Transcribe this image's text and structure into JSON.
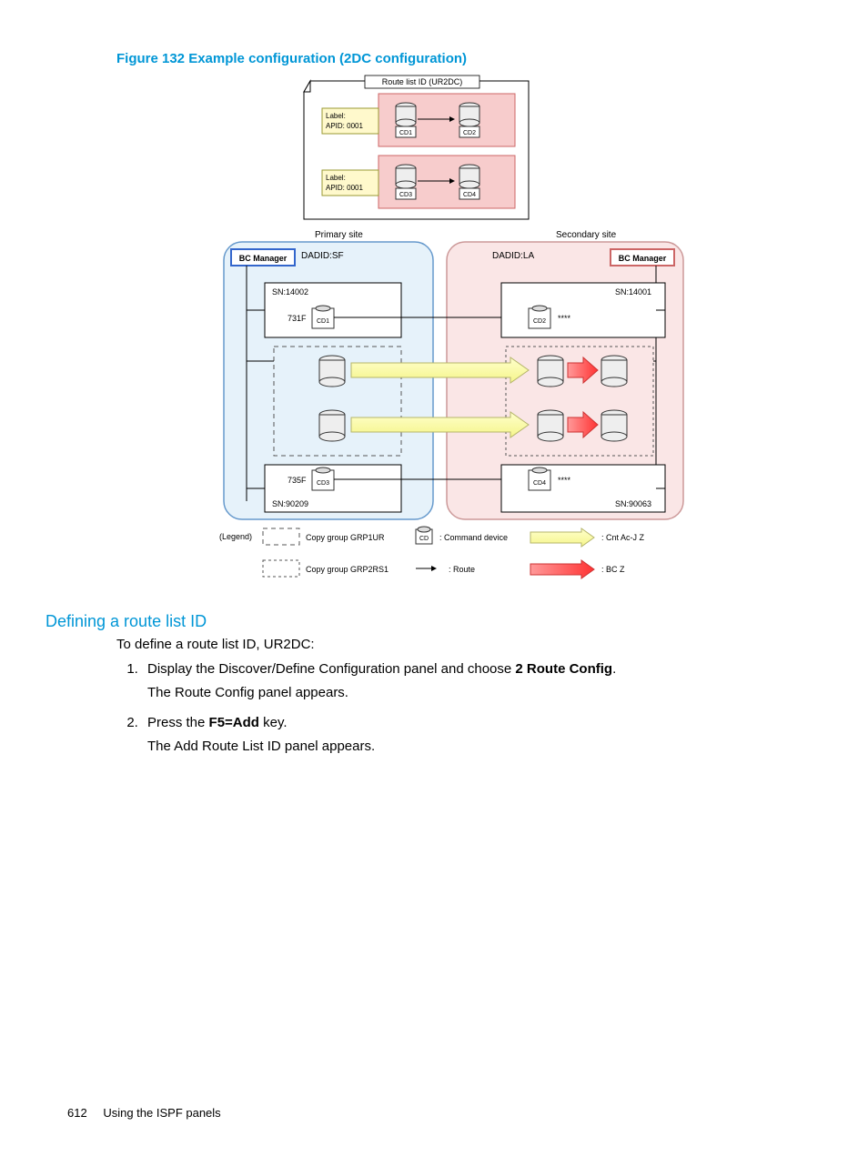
{
  "figure": {
    "caption": "Figure 132 Example configuration (2DC configuration)",
    "routeListId": "Route list ID (UR2DC)",
    "label1": "Label:",
    "apid1": "APID: 0001",
    "label2": "Label:",
    "apid2": "APID: 0001",
    "cd1": "CD1",
    "cd2": "CD2",
    "cd3": "CD3",
    "cd4": "CD4",
    "primarySite": "Primary site",
    "secondarySite": "Secondary site",
    "dadidSF": "DADID:SF",
    "dadidLA": "DADID:LA",
    "bcManagerL": "BC Manager",
    "bcManagerR": "BC Manager",
    "sn14002": "SN:14002",
    "sn14001": "SN:14001",
    "addr731F": "731F",
    "addr735F": "735F",
    "stars": "****",
    "sn90209": "SN:90209",
    "sn90063": "SN:90063",
    "legend": "(Legend)",
    "copyGroup1": "Copy group GRP1UR",
    "copyGroup2": "Copy group GRP2RS1",
    "commandDevice": ": Command device",
    "route": ": Route",
    "cdLegend": "CD",
    "cntAc": ": Cnt Ac-J Z",
    "bcz": ": BC Z"
  },
  "section": {
    "heading": "Defining a route list ID",
    "intro": "To define a route list ID, UR2DC:",
    "step1a": "Display the Discover/Define Configuration panel and choose ",
    "step1bold": "2 Route Config",
    "step1b": ".",
    "step1line2": "The Route Config panel appears.",
    "step2a": "Press the ",
    "step2bold": "F5=Add",
    "step2b": " key.",
    "step2line2": "The Add Route List ID panel appears."
  },
  "footer": {
    "pageNumber": "612",
    "chapter": "Using the ISPF panels"
  }
}
